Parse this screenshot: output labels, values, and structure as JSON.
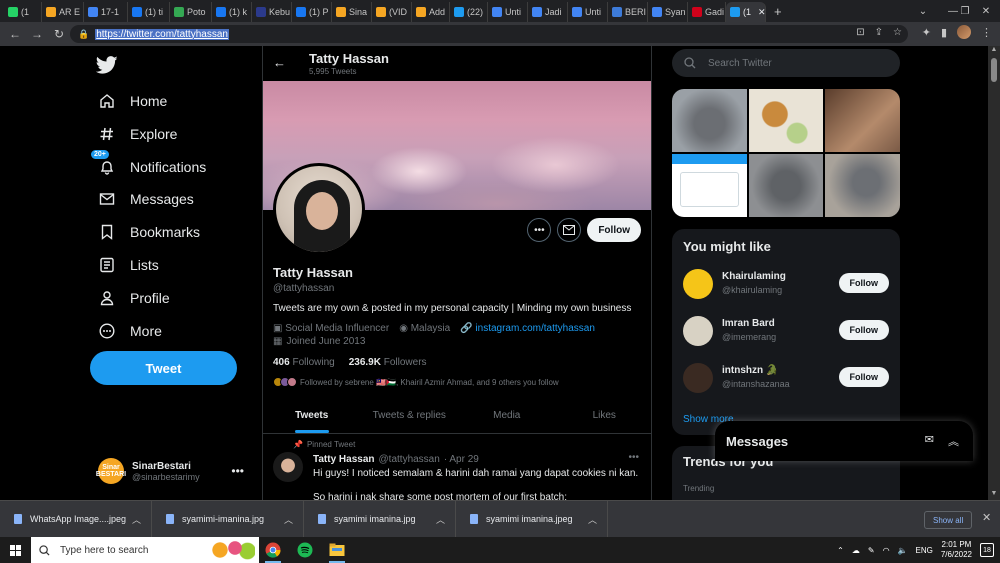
{
  "browser": {
    "tabs": [
      {
        "label": "(1",
        "color": "#25d366",
        "icon": "whatsapp-icon"
      },
      {
        "label": "AR E",
        "color": "#f5a623",
        "icon": "ar-icon"
      },
      {
        "label": "17-1",
        "color": "#4285f4",
        "icon": "google-icon"
      },
      {
        "label": "(1) ti",
        "color": "#1877f2",
        "icon": "facebook-icon"
      },
      {
        "label": "Poto",
        "color": "#34a853",
        "icon": "photo-icon"
      },
      {
        "label": "(1) k",
        "color": "#1877f2",
        "icon": "facebook-icon"
      },
      {
        "label": "Kebu",
        "color": "#2b3a8c",
        "icon": "um-icon"
      },
      {
        "label": "(1) P",
        "color": "#1877f2",
        "icon": "facebook-icon"
      },
      {
        "label": "Sina",
        "color": "#f5a623",
        "icon": "sinar-icon"
      },
      {
        "label": "(VID",
        "color": "#f5a623",
        "icon": "video-icon"
      },
      {
        "label": "Add",
        "color": "#f5a623",
        "icon": "add-icon"
      },
      {
        "label": "(22)",
        "color": "#1d9bf0",
        "icon": "twitter-icon"
      },
      {
        "label": "Unti",
        "color": "#4285f4",
        "icon": "docs-icon"
      },
      {
        "label": "Jadi",
        "color": "#4285f4",
        "icon": "docs-icon"
      },
      {
        "label": "Unti",
        "color": "#4285f4",
        "icon": "docs-icon"
      },
      {
        "label": "BERI",
        "color": "#3d7bd9",
        "icon": "news-icon"
      },
      {
        "label": "Syan",
        "color": "#4285f4",
        "icon": "google-icon"
      },
      {
        "label": "Gadi",
        "color": "#d0021b",
        "icon": "k-icon"
      },
      {
        "label": "(1",
        "color": "#1d9bf0",
        "icon": "twitter-icon",
        "active": true
      }
    ],
    "new_tab": "+",
    "url": "https://twitter.com/tattyhassan"
  },
  "sidebar": {
    "badge": "20+",
    "items": [
      {
        "label": "Home",
        "icon": "home-icon"
      },
      {
        "label": "Explore",
        "icon": "hashtag-icon"
      },
      {
        "label": "Notifications",
        "icon": "bell-icon"
      },
      {
        "label": "Messages",
        "icon": "mail-icon"
      },
      {
        "label": "Bookmarks",
        "icon": "bookmark-icon"
      },
      {
        "label": "Lists",
        "icon": "list-icon"
      },
      {
        "label": "Profile",
        "icon": "person-icon"
      },
      {
        "label": "More",
        "icon": "more-circle-icon"
      }
    ],
    "tweet_button": "Tweet",
    "account": {
      "name": "SinarBestari",
      "handle": "@sinarbestarimy",
      "avatar_text": "Sinar BESTARI"
    }
  },
  "profile": {
    "header_name": "Tatty Hassan",
    "tweet_count": "5,995 Tweets",
    "name": "Tatty Hassan",
    "handle": "@tattyhassan",
    "follow_label": "Follow",
    "bio": "Tweets are my own & posted in my personal capacity | Minding my own business",
    "category": "Social Media Influencer",
    "location": "Malaysia",
    "link": "instagram.com/tattyhassan",
    "joined": "Joined June 2013",
    "following_count": "406",
    "following_label": "Following",
    "followers_count": "236.9K",
    "followers_label": "Followers",
    "followed_by": "Followed by sebrene 🇲🇾🇵🇸, Khairil Azmir Ahmad, and 9 others you follow",
    "tabs": [
      "Tweets",
      "Tweets & replies",
      "Media",
      "Likes"
    ]
  },
  "pinned_tweet": {
    "pinned_label": "Pinned Tweet",
    "name": "Tatty Hassan",
    "handle": "@tattyhassan",
    "date": "· Apr 29",
    "text": "Hi guys! I noticed semalam & harini dah ramai yang dapat cookies ni kan.",
    "text2": "So harini i nak share some post mortem of our first batch:"
  },
  "right": {
    "search_placeholder": "Search Twitter",
    "might_like_title": "You might like",
    "suggestions": [
      {
        "name": "Khairulaming",
        "handle": "@khairulaming",
        "follow": "Follow",
        "color": "#f5c518"
      },
      {
        "name": "Imran Bard",
        "handle": "@imemerang",
        "follow": "Follow",
        "color": "#d8d2c4"
      },
      {
        "name": "intnshzn 🐊",
        "handle": "@intanshazanaa",
        "follow": "Follow",
        "color": "#3a2a22"
      }
    ],
    "show_more": "Show more",
    "trends_title": "Trends for you",
    "trends_sub": "Trending"
  },
  "messages_drawer": {
    "title": "Messages"
  },
  "downloads": {
    "items": [
      "WhatsApp Image....jpeg",
      "syamimi-imanina.jpg",
      "syamimi imanina.jpg",
      "syamimi imanina.jpeg"
    ],
    "show_all": "Show all"
  },
  "taskbar": {
    "search_placeholder": "Type here to search",
    "lang": "ENG",
    "time": "2:01 PM",
    "date": "7/6/2022",
    "notifications": "18"
  }
}
